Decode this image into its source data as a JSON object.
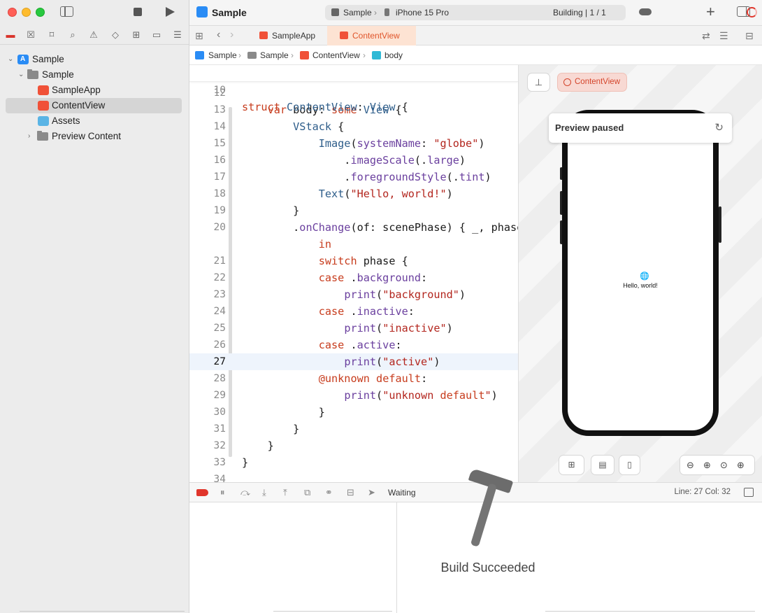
{
  "project": {
    "name": "Sample"
  },
  "toolbar": {
    "scheme": "Sample",
    "destination": "iPhone 15 Pro",
    "status": "Building | 1 / 1"
  },
  "navigator": {
    "items": [
      {
        "label": "Sample",
        "icon": "app-icon"
      },
      {
        "label": "Sample",
        "icon": "folder-icon"
      },
      {
        "label": "SampleApp",
        "icon": "swift-file-icon"
      },
      {
        "label": "ContentView",
        "icon": "swift-file-icon"
      },
      {
        "label": "Assets",
        "icon": "asset-catalog-icon"
      },
      {
        "label": "Preview Content",
        "icon": "folder-icon"
      }
    ]
  },
  "tabs": [
    {
      "label": "SampleApp"
    },
    {
      "label": "ContentView"
    }
  ],
  "breadcrumb": [
    "Sample",
    "Sample",
    "ContentView",
    "body"
  ],
  "editor": {
    "current_line": "27",
    "sticky": {
      "num": "10",
      "text": "struct ContentView: View {"
    },
    "lines": [
      {
        "num": "12",
        "text": ""
      },
      {
        "num": "13",
        "text": "    var body: some View {"
      },
      {
        "num": "14",
        "text": "        VStack {"
      },
      {
        "num": "15",
        "text": "            Image(systemName: \"globe\")"
      },
      {
        "num": "16",
        "text": "                .imageScale(.large)"
      },
      {
        "num": "17",
        "text": "                .foregroundStyle(.tint)"
      },
      {
        "num": "18",
        "text": "            Text(\"Hello, world!\")"
      },
      {
        "num": "19",
        "text": "        }"
      },
      {
        "num": "20",
        "text": "        .onChange(of: scenePhase) { _, phase"
      },
      {
        "num": "",
        "text": "            in"
      },
      {
        "num": "21",
        "text": "            switch phase {"
      },
      {
        "num": "22",
        "text": "            case .background:"
      },
      {
        "num": "23",
        "text": "                print(\"background\")"
      },
      {
        "num": "24",
        "text": "            case .inactive:"
      },
      {
        "num": "25",
        "text": "                print(\"inactive\")"
      },
      {
        "num": "26",
        "text": "            case .active:"
      },
      {
        "num": "27",
        "text": "                print(\"active\")"
      },
      {
        "num": "28",
        "text": "            @unknown default:"
      },
      {
        "num": "29",
        "text": "                print(\"unknown default\")"
      },
      {
        "num": "30",
        "text": "            }"
      },
      {
        "num": "31",
        "text": "        }"
      },
      {
        "num": "32",
        "text": "    }"
      },
      {
        "num": "33",
        "text": "}"
      },
      {
        "num": "34",
        "text": ""
      }
    ]
  },
  "canvas": {
    "chip_label": "ContentView",
    "paused_label": "Preview paused",
    "preview_text": "Hello, world!"
  },
  "debug": {
    "waiting": "Waiting",
    "line_col": "Line: 27  Col: 32"
  },
  "hud": {
    "message": "Build Succeeded"
  },
  "colors": {
    "accent": "#2a8cf5",
    "swift": "#f05138",
    "keyword": "#c73c1d",
    "string": "#b3261e",
    "error": "#e0352b"
  }
}
